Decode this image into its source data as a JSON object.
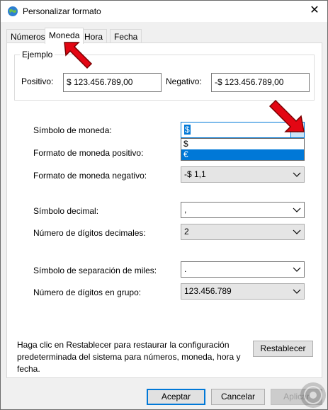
{
  "window": {
    "title": "Personalizar formato",
    "close_glyph": "✕",
    "title_icon": "globe-icon"
  },
  "tabs": [
    {
      "label": "Números",
      "active": false
    },
    {
      "label": "Moneda",
      "active": true
    },
    {
      "label": "Hora",
      "active": false
    },
    {
      "label": "Fecha",
      "active": false
    }
  ],
  "example": {
    "legend": "Ejemplo",
    "positive_label": "Positivo:",
    "positive_value": "$ 123.456.789,00",
    "negative_label": "Negativo:",
    "negative_value": "-$ 123.456.789,00"
  },
  "fields": {
    "currency_symbol": {
      "label": "Símbolo de moneda:",
      "value": "$",
      "options": [
        "$",
        "€"
      ],
      "highlighted": "€"
    },
    "positive_format": {
      "label": "Formato de moneda positivo:"
    },
    "negative_format": {
      "label": "Formato de moneda negativo:",
      "value": "-$ 1,1"
    },
    "decimal_symbol": {
      "label": "Símbolo decimal:",
      "value": ","
    },
    "decimal_digits": {
      "label": "Número de dígitos decimales:",
      "value": "2"
    },
    "thousands_symbol": {
      "label": "Símbolo de separación de miles:",
      "value": "."
    },
    "group_digits": {
      "label": "Número de dígitos en grupo:",
      "value": "123.456.789"
    }
  },
  "info": {
    "text": "Haga clic en Restablecer para restaurar la configuración predeterminada del sistema para números, moneda, hora y fecha.",
    "reset_button": "Restablecer"
  },
  "footer": {
    "accept": "Aceptar",
    "cancel": "Cancelar",
    "apply": "Aplicar"
  },
  "colors": {
    "accent": "#0078d7",
    "arrow_red": "#e30613"
  }
}
